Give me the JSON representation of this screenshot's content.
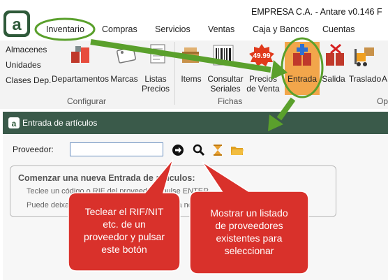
{
  "app": {
    "title": "EMPRESA C.A. - Antare v0.146 F"
  },
  "tabs": [
    "Inventario",
    "Compras",
    "Servicios",
    "Ventas",
    "Caja y Bancos",
    "Cuentas"
  ],
  "configurar": {
    "links": [
      "Almacenes",
      "Unidades",
      "Clases Dep."
    ],
    "buttons": [
      "Departamentos",
      "Marcas",
      "Listas\nPrecios"
    ],
    "group": "Configurar"
  },
  "fichas": {
    "buttons": [
      "Items",
      "Consultar\nSeriales",
      "Precios\nde Venta"
    ],
    "price_tag": "49.99",
    "group": "Fichas"
  },
  "operaciones": {
    "buttons": [
      "Entrada",
      "Salida",
      "Traslado",
      "A"
    ],
    "group": "Op"
  },
  "panel": {
    "title": "Entrada de artículos",
    "proveedor_label": "Proveedor:",
    "info_title": "Comenzar una nueva Entrada de artículos:",
    "info_line1": "Teclee un código o RIF del proveedor y pulse ENTER",
    "info_line2": "Puede deixar en blanco y pulsar ENTER para no elegir proveedor."
  },
  "callouts": {
    "left": "Teclear el RIF/NIT\netc. de un\nproveedor y pulsar\neste botón",
    "right": "Mostrar un listado\nde proveedores\nexistentes para\nseleccionar"
  },
  "colors": {
    "accent_green": "#5aa02c",
    "callout_red": "#d9312b",
    "panel_bar": "#3a5a4a",
    "entrada_highlight": "#f2a64b"
  }
}
